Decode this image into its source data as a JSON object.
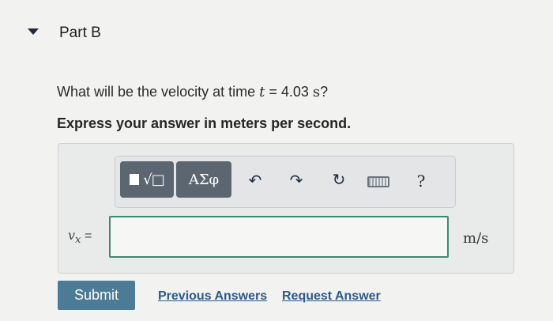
{
  "part": {
    "title": "Part B"
  },
  "question": {
    "prefix": "What will be the velocity at time ",
    "variable": "t",
    "equals": " = 4.03 ",
    "unit": "s",
    "suffix": "?"
  },
  "instruction": "Express your answer in meters per second.",
  "toolbar": {
    "templates_label": "√□",
    "greek_label": "ΑΣφ",
    "undo_symbol": "↶",
    "redo_symbol": "↷",
    "reset_symbol": "↻",
    "help_label": "?"
  },
  "answer": {
    "var_main": "v",
    "var_sub": "x",
    "var_equals": " =",
    "value": "",
    "unit": "m/s"
  },
  "actions": {
    "submit_label": "Submit",
    "previous_answers_label": "Previous Answers",
    "request_answer_label": "Request Answer"
  }
}
